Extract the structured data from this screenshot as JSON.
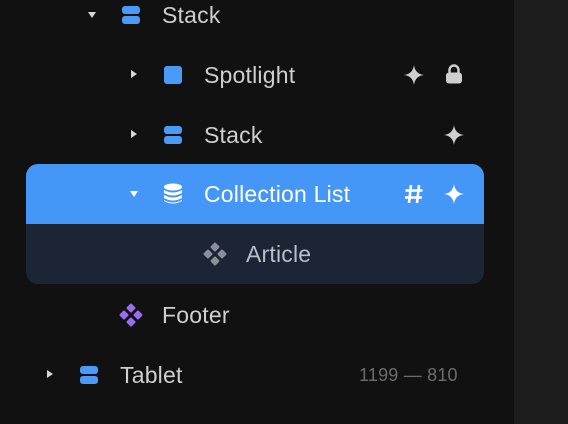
{
  "layers": {
    "stack_top": {
      "label": "Stack"
    },
    "spotlight": {
      "label": "Spotlight"
    },
    "stack_inner": {
      "label": "Stack"
    },
    "collection_list": {
      "label": "Collection List"
    },
    "article": {
      "label": "Article"
    },
    "footer": {
      "label": "Footer"
    },
    "tablet": {
      "label": "Tablet",
      "dimensions": "1199 — 810"
    }
  },
  "icons": {
    "stack": "stack-icon",
    "frame": "frame-icon",
    "database": "database-icon",
    "component": "component-icon",
    "sparkle": "sparkle-icon",
    "lock": "lock-icon",
    "hash": "hash-icon"
  },
  "colors": {
    "background": "#111111",
    "selection": "#4597f7",
    "selection_child": "#1b2535",
    "accent_blue": "#4a9af8",
    "component_purple": "#9b6cf0",
    "text": "#cfcfcf"
  }
}
